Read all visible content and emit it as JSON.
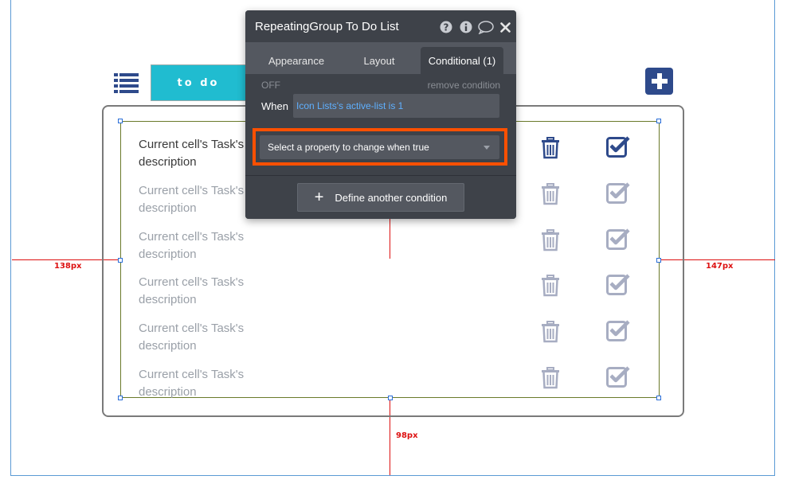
{
  "header": {
    "todo_label": "to do"
  },
  "guides": {
    "left_label": "138px",
    "right_label": "147px",
    "bottom_label": "98px"
  },
  "rows": [
    {
      "line1": "Current cell's Task's",
      "line2": "description"
    },
    {
      "line1": "Current cell's Task's",
      "line2": "description"
    },
    {
      "line1": "Current cell's Task's",
      "line2": "description"
    },
    {
      "line1": "Current cell's Task's",
      "line2": "description"
    },
    {
      "line1": "Current cell's Task's",
      "line2": "description"
    },
    {
      "line1": "Current cell's Task's",
      "line2": "description"
    }
  ],
  "panel": {
    "title": "RepeatingGroup To Do List",
    "tabs": [
      "Appearance",
      "Layout",
      "Conditional (1)"
    ],
    "active_tab": "Conditional (1)",
    "off_label": "OFF",
    "remove_label": "remove condition",
    "when_label": "When",
    "when_value": "Icon Lists's active-list is 1",
    "property_placeholder": "Select a property to change when true",
    "define_label": "Define another condition"
  },
  "icons": {
    "list": "list-icon",
    "plus": "plus-square-icon",
    "trash": "trash-icon",
    "check": "check-square-icon",
    "help": "question-circle-icon",
    "info": "info-circle-icon",
    "comment": "comment-icon",
    "close": "close-icon"
  },
  "colors": {
    "accent_teal": "#20bcd0",
    "icon_navy": "#2e4a8b",
    "icon_faded": "#a7adc2",
    "highlight": "#ff5000",
    "guide_red": "#dd1111"
  }
}
